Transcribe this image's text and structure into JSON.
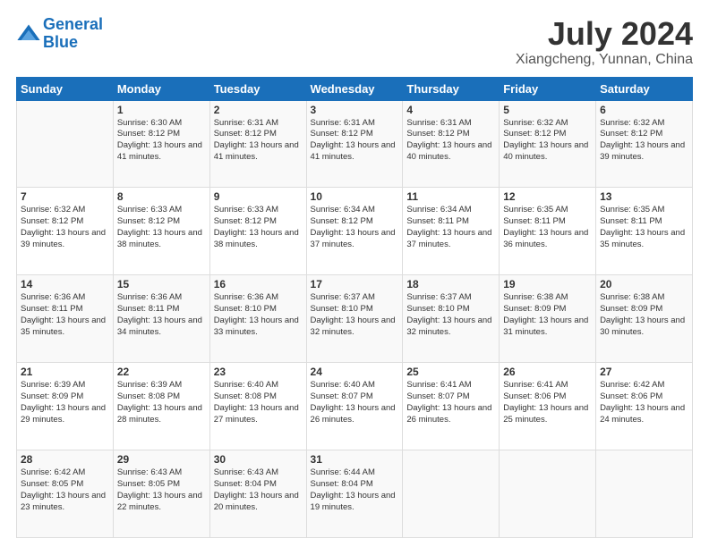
{
  "header": {
    "logo_line1": "General",
    "logo_line2": "Blue",
    "main_title": "July 2024",
    "sub_title": "Xiangcheng, Yunnan, China"
  },
  "days_of_week": [
    "Sunday",
    "Monday",
    "Tuesday",
    "Wednesday",
    "Thursday",
    "Friday",
    "Saturday"
  ],
  "weeks": [
    [
      {
        "day": "",
        "sunrise": "",
        "sunset": "",
        "daylight": ""
      },
      {
        "day": "1",
        "sunrise": "Sunrise: 6:30 AM",
        "sunset": "Sunset: 8:12 PM",
        "daylight": "Daylight: 13 hours and 41 minutes."
      },
      {
        "day": "2",
        "sunrise": "Sunrise: 6:31 AM",
        "sunset": "Sunset: 8:12 PM",
        "daylight": "Daylight: 13 hours and 41 minutes."
      },
      {
        "day": "3",
        "sunrise": "Sunrise: 6:31 AM",
        "sunset": "Sunset: 8:12 PM",
        "daylight": "Daylight: 13 hours and 41 minutes."
      },
      {
        "day": "4",
        "sunrise": "Sunrise: 6:31 AM",
        "sunset": "Sunset: 8:12 PM",
        "daylight": "Daylight: 13 hours and 40 minutes."
      },
      {
        "day": "5",
        "sunrise": "Sunrise: 6:32 AM",
        "sunset": "Sunset: 8:12 PM",
        "daylight": "Daylight: 13 hours and 40 minutes."
      },
      {
        "day": "6",
        "sunrise": "Sunrise: 6:32 AM",
        "sunset": "Sunset: 8:12 PM",
        "daylight": "Daylight: 13 hours and 39 minutes."
      }
    ],
    [
      {
        "day": "7",
        "sunrise": "",
        "sunset": "",
        "daylight": ""
      },
      {
        "day": "8",
        "sunrise": "Sunrise: 6:33 AM",
        "sunset": "Sunset: 8:12 PM",
        "daylight": "Daylight: 13 hours and 38 minutes."
      },
      {
        "day": "9",
        "sunrise": "Sunrise: 6:33 AM",
        "sunset": "Sunset: 8:12 PM",
        "daylight": "Daylight: 13 hours and 38 minutes."
      },
      {
        "day": "10",
        "sunrise": "Sunrise: 6:34 AM",
        "sunset": "Sunset: 8:12 PM",
        "daylight": "Daylight: 13 hours and 37 minutes."
      },
      {
        "day": "11",
        "sunrise": "Sunrise: 6:34 AM",
        "sunset": "Sunset: 8:11 PM",
        "daylight": "Daylight: 13 hours and 37 minutes."
      },
      {
        "day": "12",
        "sunrise": "Sunrise: 6:35 AM",
        "sunset": "Sunset: 8:11 PM",
        "daylight": "Daylight: 13 hours and 36 minutes."
      },
      {
        "day": "13",
        "sunrise": "Sunrise: 6:35 AM",
        "sunset": "Sunset: 8:11 PM",
        "daylight": "Daylight: 13 hours and 35 minutes."
      }
    ],
    [
      {
        "day": "14",
        "sunrise": "",
        "sunset": "",
        "daylight": ""
      },
      {
        "day": "15",
        "sunrise": "Sunrise: 6:36 AM",
        "sunset": "Sunset: 8:11 PM",
        "daylight": "Daylight: 13 hours and 34 minutes."
      },
      {
        "day": "16",
        "sunrise": "Sunrise: 6:36 AM",
        "sunset": "Sunset: 8:10 PM",
        "daylight": "Daylight: 13 hours and 33 minutes."
      },
      {
        "day": "17",
        "sunrise": "Sunrise: 6:37 AM",
        "sunset": "Sunset: 8:10 PM",
        "daylight": "Daylight: 13 hours and 32 minutes."
      },
      {
        "day": "18",
        "sunrise": "Sunrise: 6:37 AM",
        "sunset": "Sunset: 8:10 PM",
        "daylight": "Daylight: 13 hours and 32 minutes."
      },
      {
        "day": "19",
        "sunrise": "Sunrise: 6:38 AM",
        "sunset": "Sunset: 8:09 PM",
        "daylight": "Daylight: 13 hours and 31 minutes."
      },
      {
        "day": "20",
        "sunrise": "Sunrise: 6:38 AM",
        "sunset": "Sunset: 8:09 PM",
        "daylight": "Daylight: 13 hours and 30 minutes."
      }
    ],
    [
      {
        "day": "21",
        "sunrise": "",
        "sunset": "",
        "daylight": ""
      },
      {
        "day": "22",
        "sunrise": "Sunrise: 6:39 AM",
        "sunset": "Sunset: 8:08 PM",
        "daylight": "Daylight: 13 hours and 28 minutes."
      },
      {
        "day": "23",
        "sunrise": "Sunrise: 6:40 AM",
        "sunset": "Sunset: 8:08 PM",
        "daylight": "Daylight: 13 hours and 27 minutes."
      },
      {
        "day": "24",
        "sunrise": "Sunrise: 6:40 AM",
        "sunset": "Sunset: 8:07 PM",
        "daylight": "Daylight: 13 hours and 26 minutes."
      },
      {
        "day": "25",
        "sunrise": "Sunrise: 6:41 AM",
        "sunset": "Sunset: 8:07 PM",
        "daylight": "Daylight: 13 hours and 26 minutes."
      },
      {
        "day": "26",
        "sunrise": "Sunrise: 6:41 AM",
        "sunset": "Sunset: 8:06 PM",
        "daylight": "Daylight: 13 hours and 25 minutes."
      },
      {
        "day": "27",
        "sunrise": "Sunrise: 6:42 AM",
        "sunset": "Sunset: 8:06 PM",
        "daylight": "Daylight: 13 hours and 24 minutes."
      }
    ],
    [
      {
        "day": "28",
        "sunrise": "",
        "sunset": "",
        "daylight": ""
      },
      {
        "day": "29",
        "sunrise": "Sunrise: 6:43 AM",
        "sunset": "Sunset: 8:05 PM",
        "daylight": "Daylight: 13 hours and 22 minutes."
      },
      {
        "day": "30",
        "sunrise": "Sunrise: 6:43 AM",
        "sunset": "Sunset: 8:04 PM",
        "daylight": "Daylight: 13 hours and 20 minutes."
      },
      {
        "day": "31",
        "sunrise": "Sunrise: 6:44 AM",
        "sunset": "Sunset: 8:04 PM",
        "daylight": "Daylight: 13 hours and 19 minutes."
      },
      {
        "day": "",
        "sunrise": "",
        "sunset": "",
        "daylight": ""
      },
      {
        "day": "",
        "sunrise": "",
        "sunset": "",
        "daylight": ""
      },
      {
        "day": "",
        "sunrise": "",
        "sunset": "",
        "daylight": ""
      }
    ]
  ],
  "week1_sunday": {
    "sunrise": "Sunrise: 6:32 AM",
    "sunset": "Sunset: 8:12 PM",
    "daylight": "Daylight: 13 hours and 39 minutes."
  },
  "week2_sunday": {
    "sunrise": "Sunrise: 6:32 AM",
    "sunset": "Sunset: 8:12 PM",
    "daylight": "Daylight: 13 hours and 39 minutes."
  },
  "week3_sunday": {
    "sunrise": "Sunrise: 6:36 AM",
    "sunset": "Sunset: 8:11 PM",
    "daylight": "Daylight: 13 hours and 35 minutes."
  },
  "week4_sunday": {
    "sunrise": "Sunrise: 6:39 AM",
    "sunset": "Sunset: 8:09 PM",
    "daylight": "Daylight: 13 hours and 29 minutes."
  },
  "week5_sunday": {
    "sunrise": "Sunrise: 6:42 AM",
    "sunset": "Sunset: 8:05 PM",
    "daylight": "Daylight: 13 hours and 23 minutes."
  }
}
